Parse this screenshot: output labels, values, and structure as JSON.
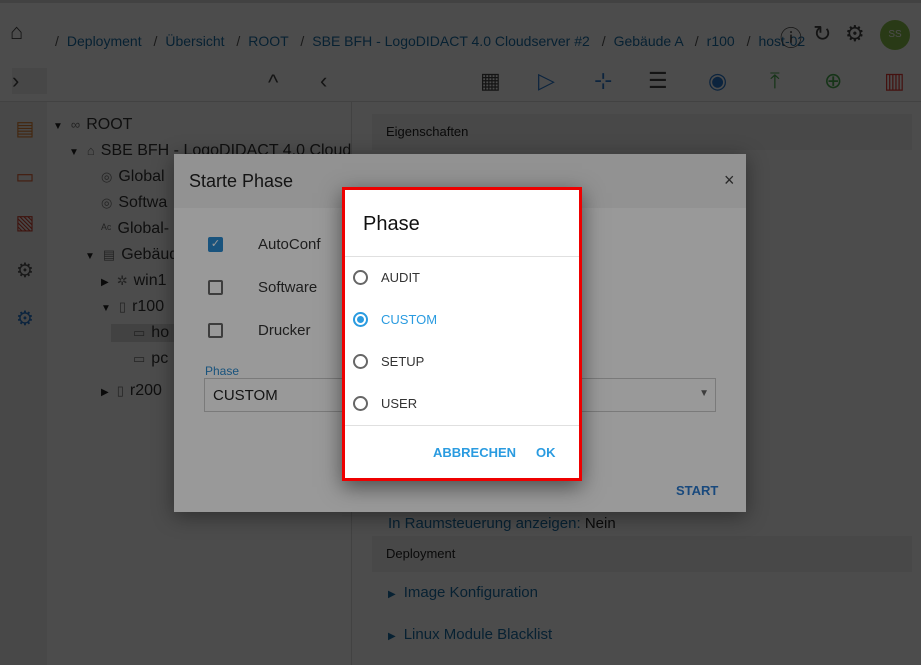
{
  "breadcrumb": [
    "Deployment",
    "Übersicht",
    "ROOT",
    "SBE BFH - LogoDIDACT 4.0 Cloudserver #2",
    "Gebäude A",
    "r100",
    "host-02"
  ],
  "user": {
    "initials": "SS",
    "avatar_color": "#8bc34a"
  },
  "tree": [
    {
      "label": "ROOT",
      "icon": "root-icon",
      "expanded": true
    },
    {
      "label": "SBE BFH - LogoDIDACT 4.0 Clouds",
      "icon": "home-icon",
      "expanded": true
    },
    {
      "label": "Global",
      "icon": "disk-icon"
    },
    {
      "label": "Softwa",
      "icon": "disk-icon"
    },
    {
      "label": "Global-",
      "icon": "autoconf-icon"
    },
    {
      "label": "Gebäude A",
      "icon": "building-icon",
      "expanded": true
    },
    {
      "label": "win1",
      "icon": "gear-icon",
      "expanded": false
    },
    {
      "label": "r100",
      "icon": "room-icon",
      "expanded": true
    },
    {
      "label": "ho",
      "icon": "monitor-icon",
      "selected": true
    },
    {
      "label": "pc",
      "icon": "monitor-icon"
    },
    {
      "label": "r200",
      "icon": "room-icon",
      "expanded": false
    }
  ],
  "right": {
    "section1": "Eigenschaften",
    "partial_text": "In Raumsteuerung anzeigen:",
    "partial_value": "Nein",
    "section2": "Deployment",
    "links": [
      "Image Konfiguration",
      "Linux Module Blacklist"
    ]
  },
  "start_dialog": {
    "title": "Starte Phase",
    "close": "×",
    "checkboxes": [
      {
        "label": "AutoConf",
        "checked": true
      },
      {
        "label": "Software",
        "checked": false
      },
      {
        "label": "Drucker",
        "checked": false
      }
    ],
    "phase_label": "Phase",
    "phase_value": "CUSTOM",
    "start": "START"
  },
  "phase_dialog": {
    "title": "Phase",
    "options": [
      "AUDIT",
      "CUSTOM",
      "SETUP",
      "USER"
    ],
    "selected": "CUSTOM",
    "cancel": "ABBRECHEN",
    "ok": "OK",
    "accent": "#2a9be0",
    "highlight_border": "#e00000"
  }
}
